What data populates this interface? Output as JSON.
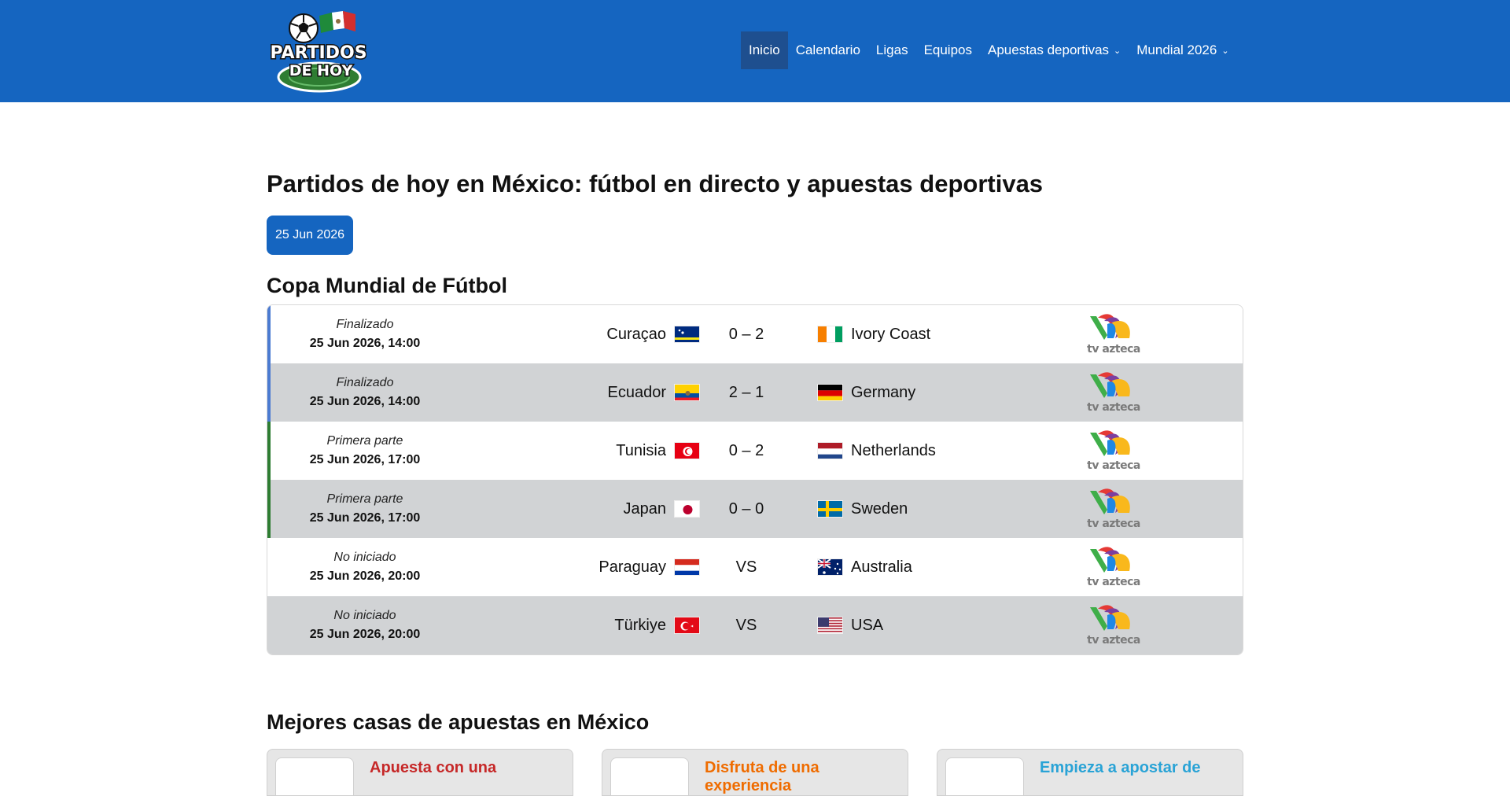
{
  "header": {
    "logo_text_1": "PARTIDOS",
    "logo_text_2": "DE HOY",
    "nav": [
      {
        "label": "Inicio",
        "active": true,
        "dropdown": false
      },
      {
        "label": "Calendario",
        "active": false,
        "dropdown": false
      },
      {
        "label": "Ligas",
        "active": false,
        "dropdown": false
      },
      {
        "label": "Equipos",
        "active": false,
        "dropdown": false
      },
      {
        "label": "Apuestas deportivas",
        "active": false,
        "dropdown": true
      },
      {
        "label": "Mundial 2026",
        "active": false,
        "dropdown": true
      }
    ]
  },
  "page": {
    "title": "Partidos de hoy en México: fútbol en directo y apuestas deportivas",
    "date": "25 Jun 2026"
  },
  "league": {
    "title": "Copa Mundial de Fútbol",
    "matches": [
      {
        "state": "finished",
        "status": "Finalizado",
        "datetime": "25 Jun 2026, 14:00",
        "home": "Curaçao",
        "home_flag": "curacao",
        "score": "0 – 2",
        "away": "Ivory Coast",
        "away_flag": "ivory-coast",
        "tv": "tv azteca"
      },
      {
        "state": "finished",
        "status": "Finalizado",
        "datetime": "25 Jun 2026, 14:00",
        "home": "Ecuador",
        "home_flag": "ecuador",
        "score": "2 – 1",
        "away": "Germany",
        "away_flag": "germany",
        "tv": "tv azteca"
      },
      {
        "state": "live",
        "status": "Primera parte",
        "datetime": "25 Jun 2026, 17:00",
        "home": "Tunisia",
        "home_flag": "tunisia",
        "score": "0 – 2",
        "away": "Netherlands",
        "away_flag": "netherlands",
        "tv": "tv azteca"
      },
      {
        "state": "live",
        "status": "Primera parte",
        "datetime": "25 Jun 2026, 17:00",
        "home": "Japan",
        "home_flag": "japan",
        "score": "0 – 0",
        "away": "Sweden",
        "away_flag": "sweden",
        "tv": "tv azteca"
      },
      {
        "state": "upcoming",
        "status": "No iniciado",
        "datetime": "25 Jun 2026, 20:00",
        "home": "Paraguay",
        "home_flag": "paraguay",
        "score": "VS",
        "away": "Australia",
        "away_flag": "australia",
        "tv": "tv azteca"
      },
      {
        "state": "upcoming",
        "status": "No iniciado",
        "datetime": "25 Jun 2026, 20:00",
        "home": "Türkiye",
        "home_flag": "turkiye",
        "score": "VS",
        "away": "USA",
        "away_flag": "usa",
        "tv": "tv azteca"
      }
    ]
  },
  "betting": {
    "title": "Mejores casas de apuestas en México",
    "cards": [
      {
        "headline": "Apuesta con una",
        "color": "#c62828"
      },
      {
        "headline": "Disfruta de una experiencia",
        "color": "#ef6c00"
      },
      {
        "headline": "Empieza a apostar de",
        "color": "#29a3d6"
      }
    ]
  },
  "colors": {
    "header_bg": "#1565c0",
    "nav_active_bg": "#1e4f8f",
    "finished_accent": "#4b7bd1",
    "live_accent": "#2e7d32",
    "row_alt": "#d1d3d5"
  }
}
